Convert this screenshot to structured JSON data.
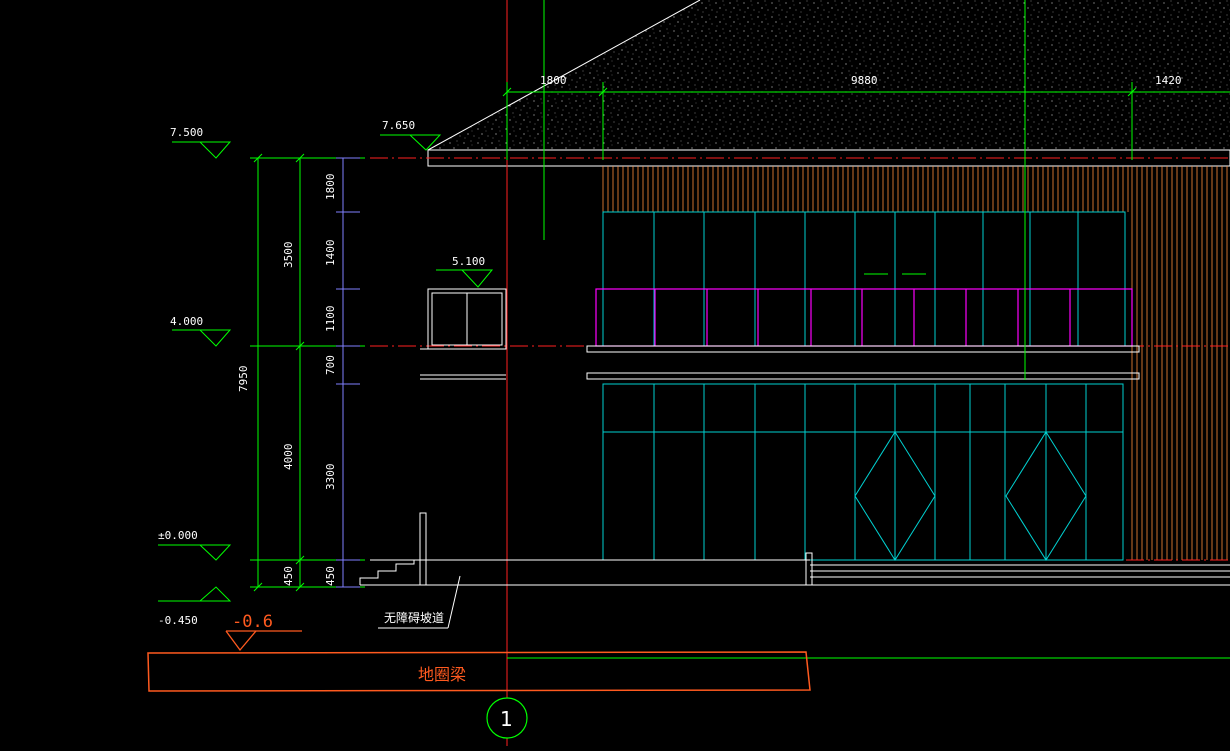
{
  "colors": {
    "background": "#000000",
    "dimension_line": "#00ff00",
    "axis_line": "#ff2020",
    "glazing": "#00d0d0",
    "railing": "#ff00ff",
    "cladding": "#ff8c3a",
    "annotation": "#ff5a1f",
    "outline": "#ffffff",
    "tick": "#8080ff"
  },
  "top_dimensions": [
    "1800",
    "9880",
    "1420"
  ],
  "level_marks": {
    "roof": "7.500",
    "eave": "7.650",
    "canopy": "5.100",
    "second_floor": "4.000",
    "ground": "±0.000",
    "outdoor": "-0.450"
  },
  "left_dimensions": {
    "overall": "7950",
    "upper_storey": "3500",
    "lower_storey": "4000",
    "plinth_outer": "450",
    "plinth_inner": "450",
    "seg_top": "1800",
    "seg_upper_mid": "1400",
    "seg_rail": "1100",
    "seg_slab": "700",
    "seg_ground": "3300"
  },
  "labels": {
    "ramp_note": "无障碍坡道",
    "ground_beam": "地圈梁",
    "beam_level": "-0.6",
    "axis_bubble": "1"
  }
}
